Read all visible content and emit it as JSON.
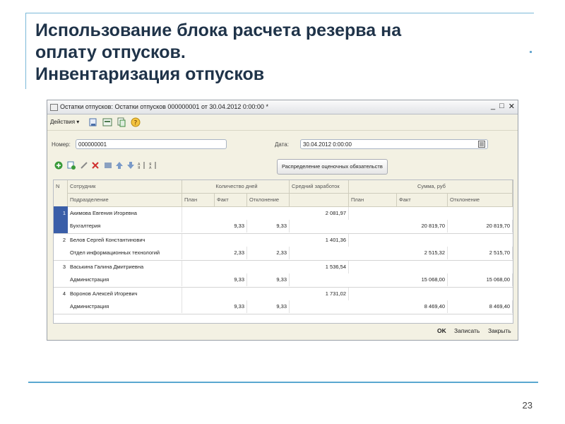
{
  "slide": {
    "title_lines": [
      "Использование блока расчета резерва на",
      "оплату отпусков.",
      "Инвентаризация отпусков"
    ],
    "page_number": "23"
  },
  "window": {
    "title": "Остатки отпусков: Остатки отпусков 000000001 от 30.04.2012 0:00:00 *",
    "controls": [
      "_",
      "□",
      "✕"
    ],
    "actions_label": "Действия ▾",
    "number_label": "Номер:",
    "number_value": "000000001",
    "date_label": "Дата:",
    "date_value": "30.04.2012  0:00:00",
    "distribute_button": "Распределение оценочных обязательств",
    "table": {
      "headers_top": {
        "n": "N",
        "employee": "Сотрудник",
        "days": "Количество дней",
        "avg": "Средний заработок",
        "sum": "Сумма, руб"
      },
      "headers_sub": {
        "dept": "Подразделение",
        "plan": "План",
        "fact": "Факт",
        "dev": "Отклонение",
        "sum_plan": "План",
        "sum_fact": "Факт",
        "sum_dev": "Отклонение"
      },
      "rows": [
        {
          "n": "1",
          "employee": "Акимова Евгения Игоревна",
          "dept": "Бухгалтерия",
          "plan": "",
          "fact": "9,33",
          "dev": "9,33",
          "avg": "2 081,97",
          "sum_plan": "",
          "sum_fact": "20 819,70",
          "sum_dev": "20 819,70"
        },
        {
          "n": "2",
          "employee": "Белов Сергей Константинович",
          "dept": "Отдел информационных технологий",
          "plan": "",
          "fact": "2,33",
          "dev": "2,33",
          "avg": "1 401,36",
          "sum_plan": "",
          "sum_fact": "2 515,32",
          "sum_dev": "2 515,70"
        },
        {
          "n": "3",
          "employee": "Васькина Галина Дмитриевна",
          "dept": "Администрация",
          "plan": "",
          "fact": "9,33",
          "dev": "9,33",
          "avg": "1 536,54",
          "sum_plan": "",
          "sum_fact": "15 068,00",
          "sum_dev": "15 068,00"
        },
        {
          "n": "4",
          "employee": "Воронов Алексей Игоревич",
          "dept": "Администрация",
          "plan": "",
          "fact": "9,33",
          "dev": "9,33",
          "avg": "1 731,02",
          "sum_plan": "",
          "sum_fact": "8 469,40",
          "sum_dev": "8 469,40"
        }
      ]
    },
    "footer": {
      "ok": "OK",
      "save": "Записать",
      "close": "Закрыть"
    }
  },
  "colors": {
    "title": "#1f3349",
    "accent_line": "#5aa8d0",
    "selection": "#3a5ea8"
  }
}
